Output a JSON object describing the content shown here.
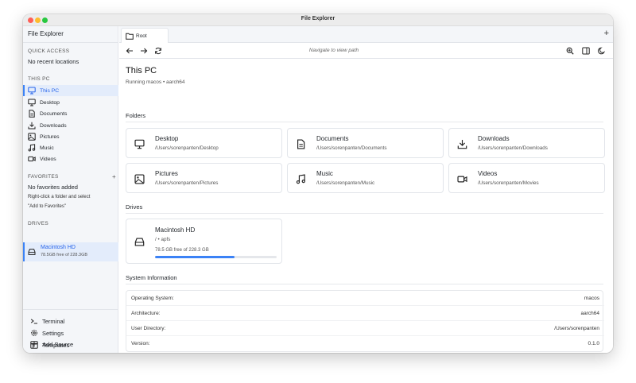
{
  "window": {
    "title": "File Explorer"
  },
  "sidebar": {
    "app_name": "File Explorer",
    "quick_access": {
      "heading": "QUICK ACCESS",
      "empty_text": "No recent locations"
    },
    "this_pc": {
      "heading": "THIS PC",
      "items": [
        {
          "label": "This PC",
          "icon": "monitor-icon",
          "active": true
        },
        {
          "label": "Desktop",
          "icon": "monitor-icon"
        },
        {
          "label": "Documents",
          "icon": "document-icon"
        },
        {
          "label": "Downloads",
          "icon": "download-icon"
        },
        {
          "label": "Pictures",
          "icon": "image-icon"
        },
        {
          "label": "Music",
          "icon": "music-icon"
        },
        {
          "label": "Videos",
          "icon": "video-icon"
        }
      ]
    },
    "favorites": {
      "heading": "FAVORITES",
      "add_label": "+",
      "empty_title": "No favorites added",
      "hint_line1": "Right-click a folder and select",
      "hint_line2": "\"Add to Favorites\""
    },
    "drives": {
      "heading": "DRIVES",
      "items": [
        {
          "name": "Macintosh HD",
          "detail": "78.5GB free of 228.3GB",
          "icon": "drive-icon"
        }
      ]
    },
    "bottom": [
      {
        "label": "Terminal",
        "icon": "terminal-icon"
      },
      {
        "label": "Settings",
        "icon": "gear-icon"
      },
      {
        "label": "Templates",
        "icon": "template-icon"
      },
      {
        "label": "Add Source",
        "icon": "plus-icon"
      }
    ]
  },
  "tabs": [
    {
      "label": "Root",
      "icon": "folder-icon"
    }
  ],
  "tabbar": {
    "new_tab": "+"
  },
  "toolbar": {
    "path_placeholder": "Navigate to view path"
  },
  "page": {
    "title": "This PC",
    "subtitle": "Running macos • aarch64"
  },
  "folders": {
    "heading": "Folders",
    "items": [
      {
        "name": "Desktop",
        "path": "/Users/sorenpanten/Desktop",
        "icon": "monitor-icon"
      },
      {
        "name": "Documents",
        "path": "/Users/sorenpanten/Documents",
        "icon": "document-icon"
      },
      {
        "name": "Downloads",
        "path": "/Users/sorenpanten/Downloads",
        "icon": "download-icon"
      },
      {
        "name": "Pictures",
        "path": "/Users/sorenpanten/Pictures",
        "icon": "image-icon"
      },
      {
        "name": "Music",
        "path": "/Users/sorenpanten/Music",
        "icon": "music-icon"
      },
      {
        "name": "Videos",
        "path": "/Users/sorenpanten/Movies",
        "icon": "video-icon"
      }
    ]
  },
  "drives": {
    "heading": "Drives",
    "items": [
      {
        "name": "Macintosh HD",
        "fs": "/ • apfs",
        "free": "78.5 GB free of 228.3 GB",
        "used_fraction": 0.656
      }
    ]
  },
  "system": {
    "heading": "System Information",
    "rows": [
      {
        "key": "Operating System:",
        "value": "macos"
      },
      {
        "key": "Architecture:",
        "value": "aarch64"
      },
      {
        "key": "User Directory:",
        "value": "/Users/sorenpanten"
      },
      {
        "key": "Version:",
        "value": "0.1.0"
      }
    ]
  },
  "colors": {
    "accent": "#3b82f6",
    "active_bg": "#e3ecfb",
    "sidebar_bg": "#f4f6f9"
  }
}
